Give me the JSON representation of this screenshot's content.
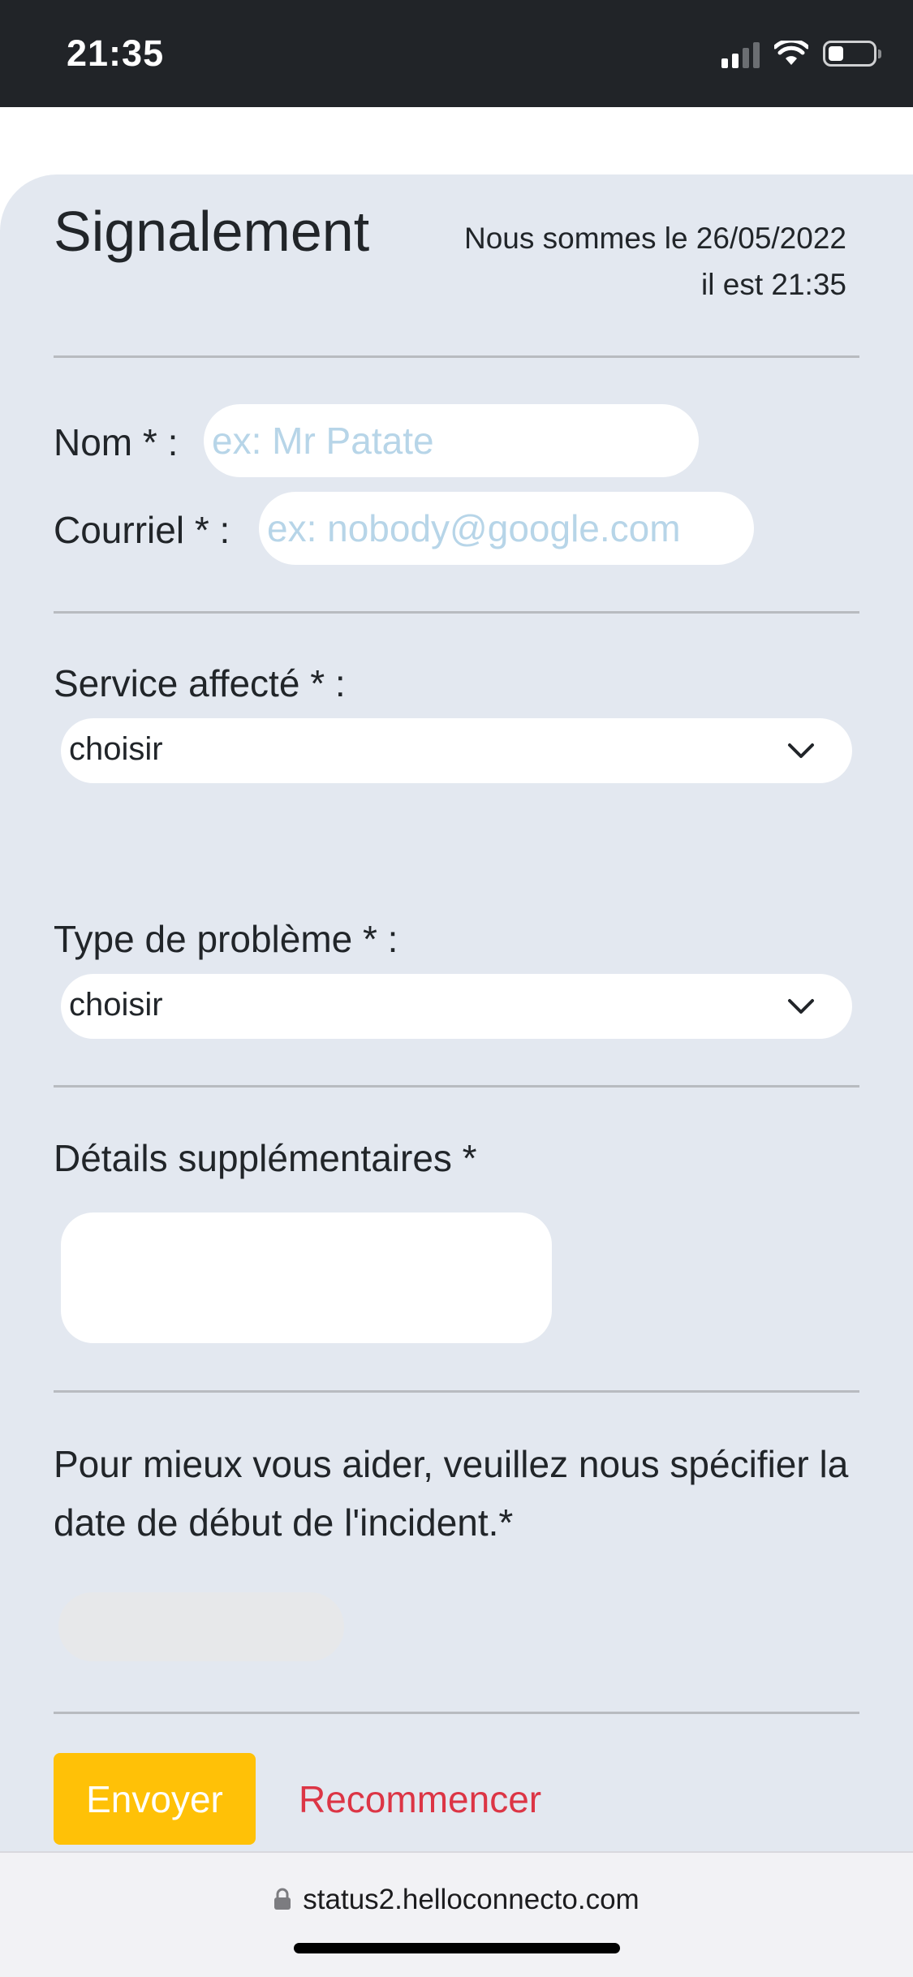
{
  "status_bar": {
    "time": "21:35",
    "icons": [
      "cellular-signal-icon",
      "wifi-icon",
      "battery-icon"
    ]
  },
  "form": {
    "title": "Signalement",
    "date_line": "Nous sommes le 26/05/2022",
    "time_line": "il est 21:35",
    "name": {
      "label": "Nom * :",
      "placeholder": "ex: Mr Patate",
      "value": ""
    },
    "email": {
      "label": "Courriel * :",
      "placeholder": "ex: nobody@google.com",
      "value": ""
    },
    "service": {
      "label": "Service affecté * :",
      "selected": "choisir"
    },
    "problem_type": {
      "label": "Type de problème * :",
      "selected": "choisir"
    },
    "details": {
      "label": "Détails supplémentaires *",
      "value": ""
    },
    "incident_date": {
      "prompt": "Pour mieux vous aider, veuillez nous spécifier la date de début de l'incident.*",
      "value": ""
    },
    "submit_label": "Envoyer",
    "reset_label": "Recommencer"
  },
  "browser": {
    "url": "status2.helloconnecto.com"
  },
  "colors": {
    "status_bar": "#212428",
    "card_background": "#e3e8f0",
    "placeholder": "#b7d5e8",
    "submit_button": "#ffc107",
    "reset_link": "#dc3545"
  }
}
